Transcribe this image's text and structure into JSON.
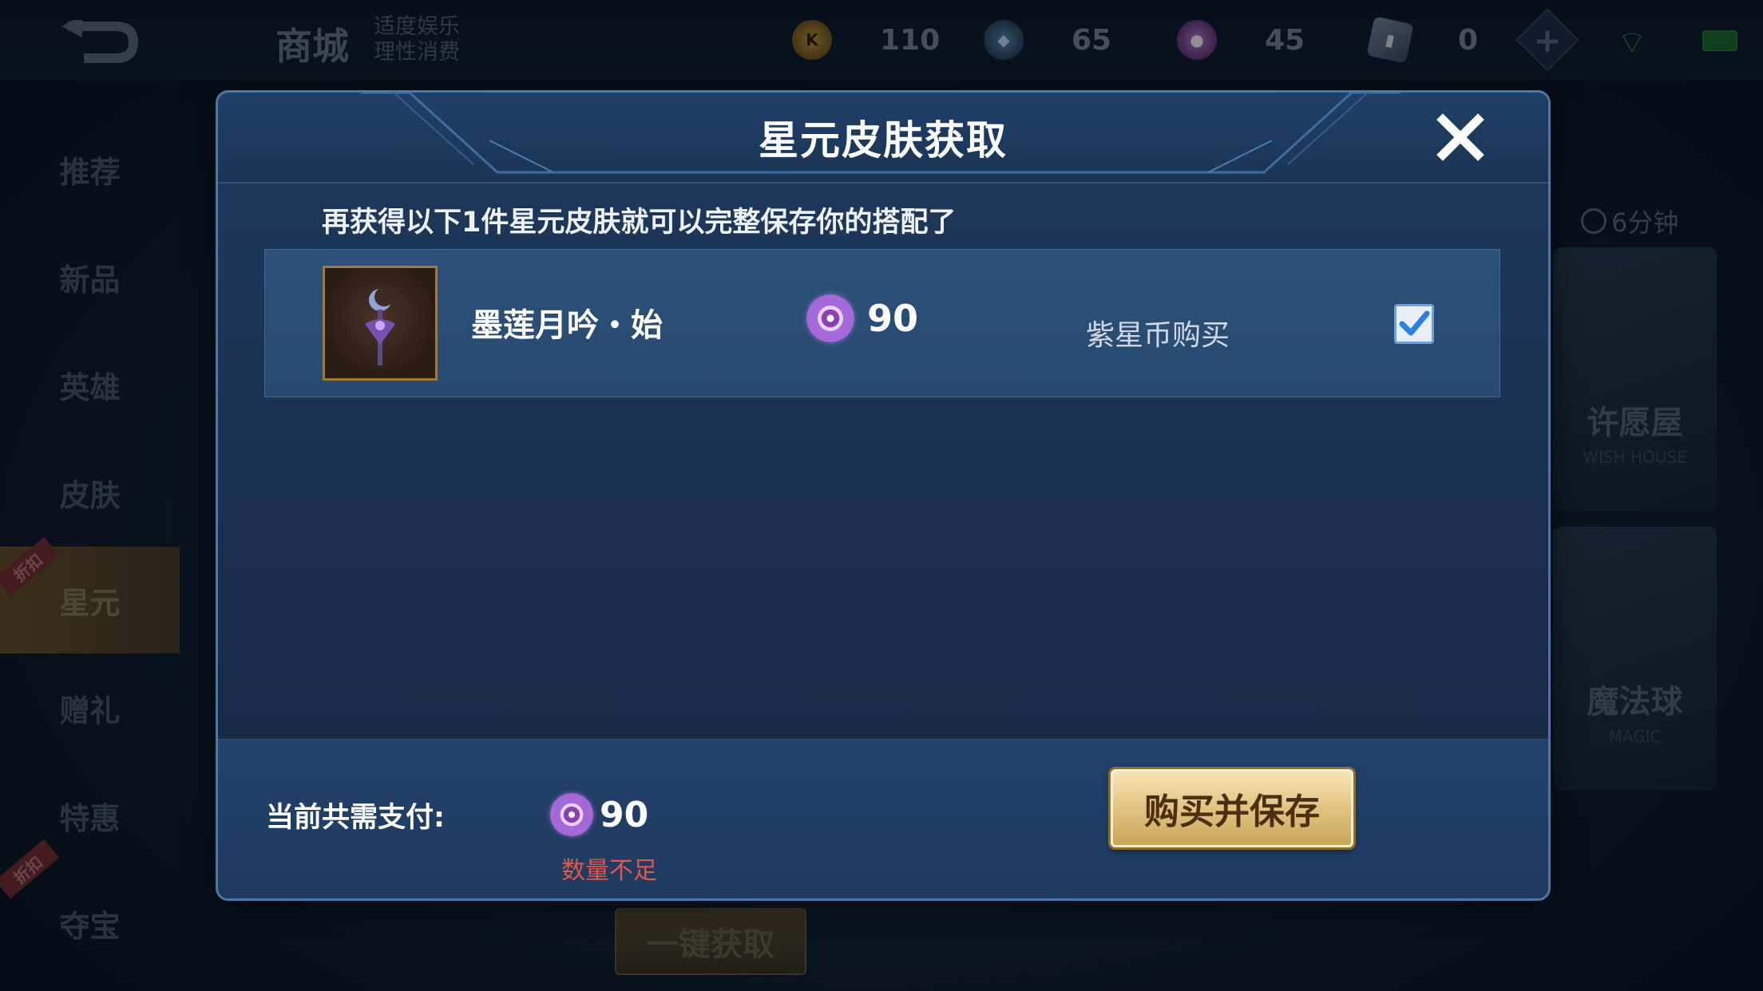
{
  "topbar": {
    "title": "商城",
    "tagline_line1": "适度娱乐",
    "tagline_line2": "理性消费",
    "currencies": [
      {
        "icon": "honor-coin-icon",
        "value": "110"
      },
      {
        "icon": "diamond-coin-icon",
        "value": "65"
      },
      {
        "icon": "purple-star-coin-icon",
        "value": "45"
      },
      {
        "icon": "ticket-icon",
        "value": "0"
      }
    ]
  },
  "sidebar": {
    "items": [
      {
        "label": "推荐"
      },
      {
        "label": "新品"
      },
      {
        "label": "英雄"
      },
      {
        "label": "皮肤"
      },
      {
        "label": "星元",
        "active": true
      },
      {
        "label": "赠礼"
      },
      {
        "label": "特惠"
      },
      {
        "label": "夺宝"
      }
    ],
    "discount_tag": "折扣"
  },
  "right_panel": {
    "timer": "6分钟",
    "card1_title": "许愿屋",
    "card1_sub": "WISH HOUSE",
    "card2_title": "魔法球",
    "card2_sub": "MAGIC"
  },
  "background_button": "一键获取",
  "modal": {
    "title": "星元皮肤获取",
    "subtitle": "再获得以下1件星元皮肤就可以完整保存你的搭配了",
    "item": {
      "name": "墨莲月吟・始",
      "price": "90",
      "pay_method": "紫星币购买",
      "checked": true
    },
    "footer": {
      "total_label": "当前共需支付:",
      "total_value": "90",
      "insufficient": "数量不足",
      "buy_button": "购买并保存"
    }
  },
  "colors": {
    "modal_bg": "#1e3a5e",
    "accent_gold": "#e2c481",
    "warning_red": "#e0564a",
    "purple_coin": "#a568d8"
  }
}
